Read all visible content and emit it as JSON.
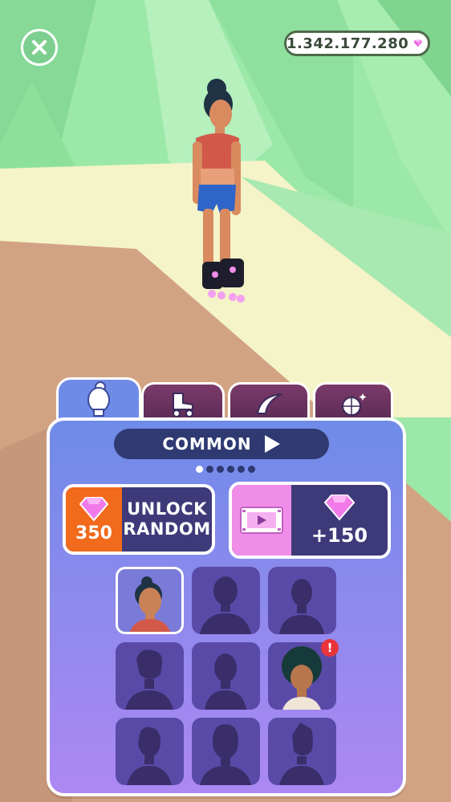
{
  "hud": {
    "gems_total": "1.342.177.280",
    "icons": {
      "close": "close-icon",
      "gem": "gem-icon"
    }
  },
  "tabs": [
    {
      "name": "character",
      "icon": "character-head-icon",
      "active": true
    },
    {
      "name": "skates",
      "icon": "roller-skate-icon",
      "active": false
    },
    {
      "name": "trail",
      "icon": "trail-swoosh-icon",
      "active": false
    },
    {
      "name": "effects",
      "icon": "disco-ball-icon",
      "active": false
    }
  ],
  "rarity": {
    "label": "COMMON",
    "icon": "play-arrow-icon"
  },
  "pager": {
    "total": 6,
    "current": 1
  },
  "unlock_random": {
    "price": "350",
    "line1": "UNLOCK",
    "line2": "RANDOM"
  },
  "video_reward": {
    "amount": "+150",
    "icon": "video-film-icon"
  },
  "characters": [
    {
      "state": "selected",
      "look": "bun"
    },
    {
      "state": "locked"
    },
    {
      "state": "locked"
    },
    {
      "state": "locked"
    },
    {
      "state": "locked"
    },
    {
      "state": "unlocked",
      "look": "afro",
      "badge": "!"
    },
    {
      "state": "locked"
    },
    {
      "state": "locked"
    },
    {
      "state": "locked"
    }
  ],
  "colors": {
    "accent_orange": "#f26a1b",
    "accent_pink": "#f08de8",
    "gem_pink": "#f07ae8",
    "panel_top": "#6f8be8",
    "panel_bottom": "#ad88f2",
    "badge_red": "#e8343a"
  }
}
